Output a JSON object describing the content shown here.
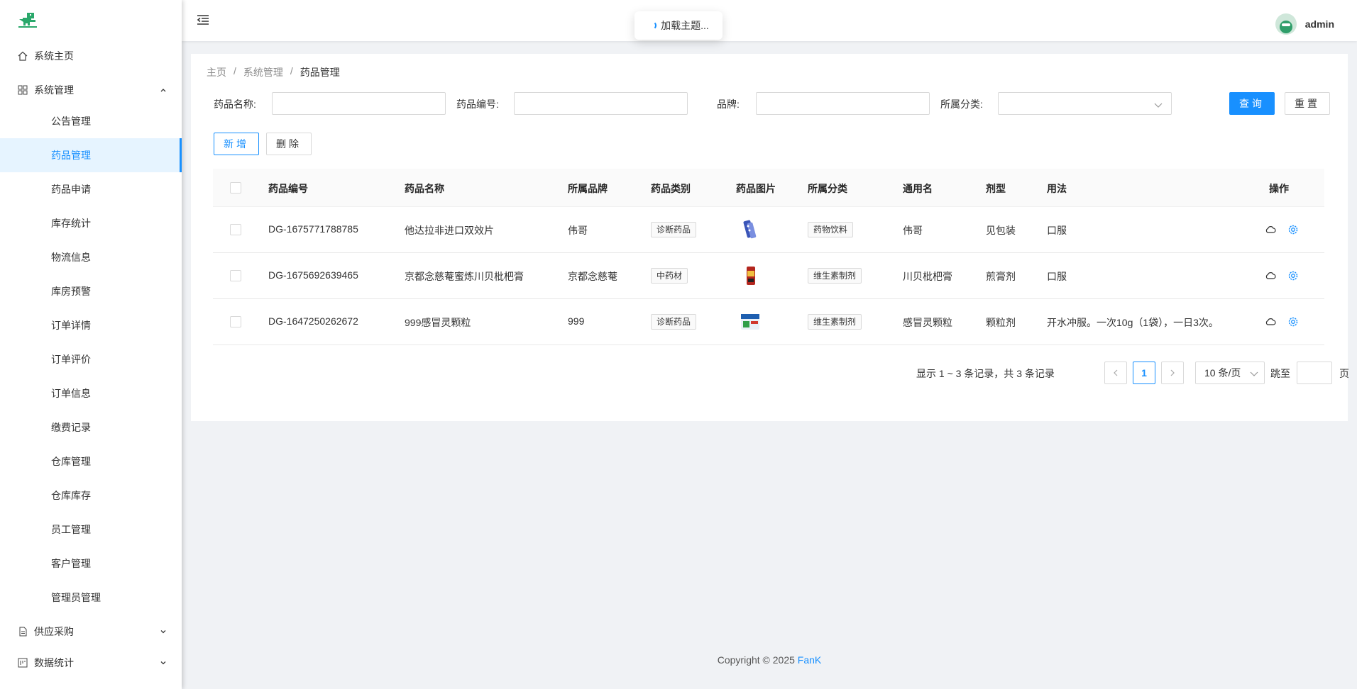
{
  "sidebar": {
    "items": [
      {
        "label": "系统主页",
        "icon": "home-icon"
      },
      {
        "label": "系统管理",
        "icon": "appstore-icon",
        "expanded": true,
        "children": [
          "公告管理",
          "药品管理",
          "药品申请",
          "库存统计",
          "物流信息",
          "库房预警",
          "订单详情",
          "订单评价",
          "订单信息",
          "缴费记录",
          "仓库管理",
          "仓库库存",
          "员工管理",
          "客户管理",
          "管理员管理"
        ]
      },
      {
        "label": "供应采购",
        "icon": "file-icon"
      },
      {
        "label": "数据统计",
        "icon": "chart-icon"
      }
    ],
    "active_child": "药品管理"
  },
  "header": {
    "user": "admin",
    "toast": "加载主题..."
  },
  "breadcrumb": [
    "主页",
    "系统管理",
    "药品管理"
  ],
  "search": {
    "name_label": "药品名称:",
    "code_label": "药品编号:",
    "brand_label": "品牌:",
    "category_label": "所属分类:",
    "query_button": "查询",
    "reset_button": "重置"
  },
  "actions": {
    "add_button": "新增",
    "delete_button": "删除"
  },
  "table": {
    "columns": [
      "药品编号",
      "药品名称",
      "所属品牌",
      "药品类别",
      "药品图片",
      "所属分类",
      "通用名",
      "剂型",
      "用法",
      "操作"
    ],
    "rows": [
      {
        "code": "DG-1675771788785",
        "name": "他达拉非进口双效片",
        "brand": "伟哥",
        "type": "诊断药品",
        "category": "药物饮料",
        "generic": "伟哥",
        "form": "见包装",
        "usage": "口服"
      },
      {
        "code": "DG-1675692639465",
        "name": "京都念慈菴蜜炼川贝枇杷膏",
        "brand": "京都念慈菴",
        "type": "中药材",
        "category": "维生素制剂",
        "generic": "川贝枇杷膏",
        "form": "煎膏剂",
        "usage": "口服"
      },
      {
        "code": "DG-1647250262672",
        "name": "999感冒灵颗粒",
        "brand": "999",
        "type": "诊断药品",
        "category": "维生素制剂",
        "generic": "感冒灵颗粒",
        "form": "颗粒剂",
        "usage": "开水冲服。一次10g（1袋），一日3次。"
      }
    ]
  },
  "pagination": {
    "total_text": "显示 1 ~ 3 条记录，共 3 条记录",
    "current_page": "1",
    "page_size": "10 条/页",
    "jump_label": "跳至",
    "page_suffix": "页"
  },
  "footer": {
    "prefix": "Copyright © 2025 ",
    "brand": "FanK"
  },
  "colors": {
    "primary": "#1890ff",
    "sidebar_active_bg": "#e6f4ff",
    "page_bg": "#f0f2f5"
  }
}
